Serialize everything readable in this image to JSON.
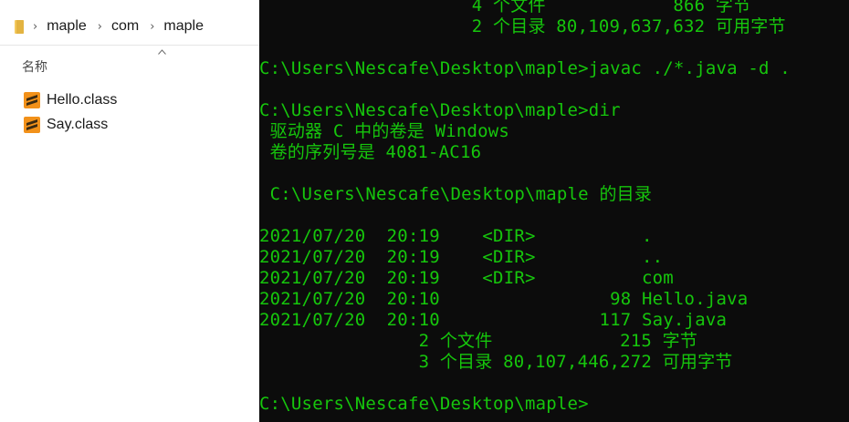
{
  "explorer": {
    "breadcrumb": [
      "maple",
      "com",
      "maple"
    ],
    "column_header": "名称",
    "files": [
      {
        "name": "Hello.class",
        "icon": "sublime-text-icon"
      },
      {
        "name": "Say.class",
        "icon": "sublime-text-icon"
      }
    ]
  },
  "console": {
    "text_color": "#16c60c",
    "lines": [
      "                    4 个文件            866 字节",
      "                    2 个目录 80,109,637,632 可用字节",
      "",
      "C:\\Users\\Nescafe\\Desktop\\maple>javac ./*.java -d .",
      "",
      "C:\\Users\\Nescafe\\Desktop\\maple>dir",
      " 驱动器 C 中的卷是 Windows",
      " 卷的序列号是 4081-AC16",
      "",
      " C:\\Users\\Nescafe\\Desktop\\maple 的目录",
      "",
      "2021/07/20  20:19    <DIR>          .",
      "2021/07/20  20:19    <DIR>          ..",
      "2021/07/20  20:19    <DIR>          com",
      "2021/07/20  20:10                98 Hello.java",
      "2021/07/20  20:10               117 Say.java",
      "               2 个文件            215 字节",
      "               3 个目录 80,107,446,272 可用字节",
      "",
      "C:\\Users\\Nescafe\\Desktop\\maple>"
    ]
  }
}
